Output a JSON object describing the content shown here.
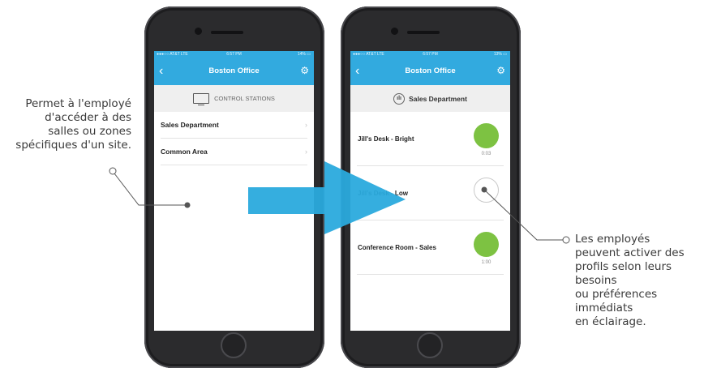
{
  "left_callout": {
    "lines": [
      "Permet à l'employé",
      "d'accéder à des",
      "salles ou zones",
      "spécifiques d'un site."
    ]
  },
  "right_callout": {
    "text": "Les employés\npeuvent activer des\nprofils selon leurs\nbesoins\nou préférences\nimmédiats\nen éclairage."
  },
  "phone_left": {
    "status": {
      "carrier": "●●●○○ AT&T  LTE",
      "time": "6:57 PM",
      "battery": "14% ▭"
    },
    "nav": {
      "back": "‹",
      "title": "Boston Office",
      "gear_icon": "gear-icon"
    },
    "header": {
      "label": "CONTROL STATIONS",
      "icon": "tv-icon"
    },
    "items": [
      {
        "label": "Sales Department",
        "chevron": "›"
      },
      {
        "label": "Common Area",
        "chevron": "›"
      }
    ]
  },
  "phone_right": {
    "status": {
      "carrier": "●●●○○ AT&T  LTE",
      "time": "6:57 PM",
      "battery": "13% ▭"
    },
    "nav": {
      "back": "‹",
      "title": "Boston Office",
      "gear_icon": "gear-icon"
    },
    "header": {
      "label": "Sales Department",
      "icon": "department-icon",
      "icon_glyph": "ılı"
    },
    "scenes": [
      {
        "label": "Jill's Desk - Bright",
        "state": "on",
        "time": "0:03"
      },
      {
        "label": "Jill's Desk - Low",
        "state": "off",
        "time": ""
      },
      {
        "label": "Conference Room - Sales",
        "state": "on",
        "time": "1:00"
      }
    ]
  },
  "colors": {
    "accent": "#32aadf",
    "arrow": "#2aaadd",
    "active": "#7dc242"
  }
}
